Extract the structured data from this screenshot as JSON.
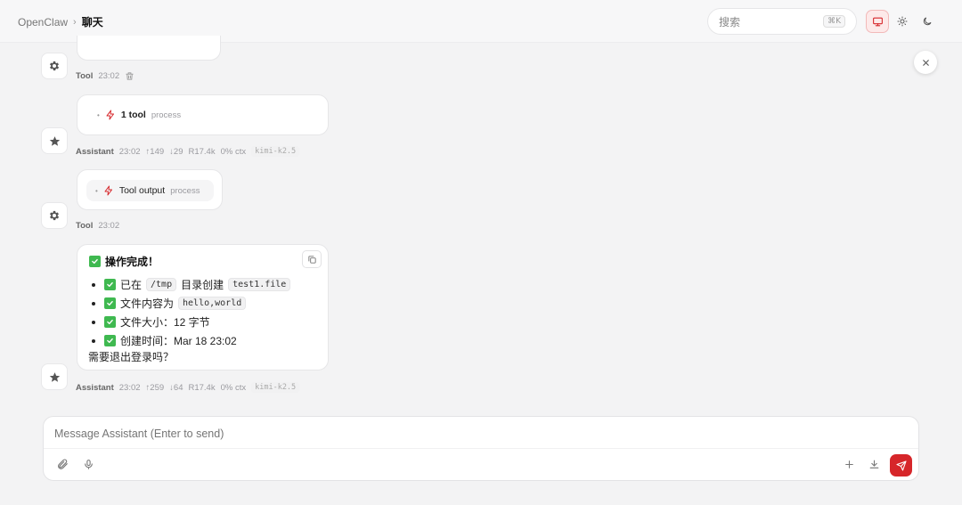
{
  "header": {
    "breadcrumb_root": "OpenClaw",
    "breadcrumb_sep": "›",
    "breadcrumb_current": "聊天",
    "search_placeholder": "搜索",
    "search_shortcut": "⌘K",
    "theme_options": [
      "system",
      "light",
      "dark"
    ],
    "active_theme": "system"
  },
  "messages": [
    {
      "role": "tool",
      "author": "Tool",
      "time": "23:02",
      "deletable": true
    },
    {
      "role": "assistant",
      "author": "Assistant",
      "tool_call": {
        "label": "1 tool",
        "tag": "process"
      },
      "time": "23:02",
      "tokens_in": "↑149",
      "tokens_out": "↓29",
      "read": "R17.4k",
      "ctx": "0% ctx",
      "model": "kimi-k2.5"
    },
    {
      "role": "tool",
      "author": "Tool",
      "tool_output": {
        "label": "Tool output",
        "tag": "process"
      },
      "time": "23:02"
    },
    {
      "role": "assistant",
      "author": "Assistant",
      "title": "操作完成！",
      "items": [
        {
          "prefix": "已在",
          "code1": "/tmp",
          "mid": "目录创建",
          "code2": "test1.file"
        },
        {
          "prefix": "文件内容为",
          "code1": "hello,world"
        },
        {
          "text": "文件大小：12 字节"
        },
        {
          "text": "创建时间：Mar 18 23:02"
        }
      ],
      "followup": "需要退出登录吗？",
      "time": "23:02",
      "tokens_in": "↑259",
      "tokens_out": "↓64",
      "read": "R17.4k",
      "ctx": "0% ctx",
      "model": "kimi-k2.5"
    }
  ],
  "composer": {
    "placeholder": "Message Assistant (Enter to send)"
  },
  "colors": {
    "accent": "#d6262a",
    "check": "#3fb950",
    "background": "#f3f3f4"
  }
}
